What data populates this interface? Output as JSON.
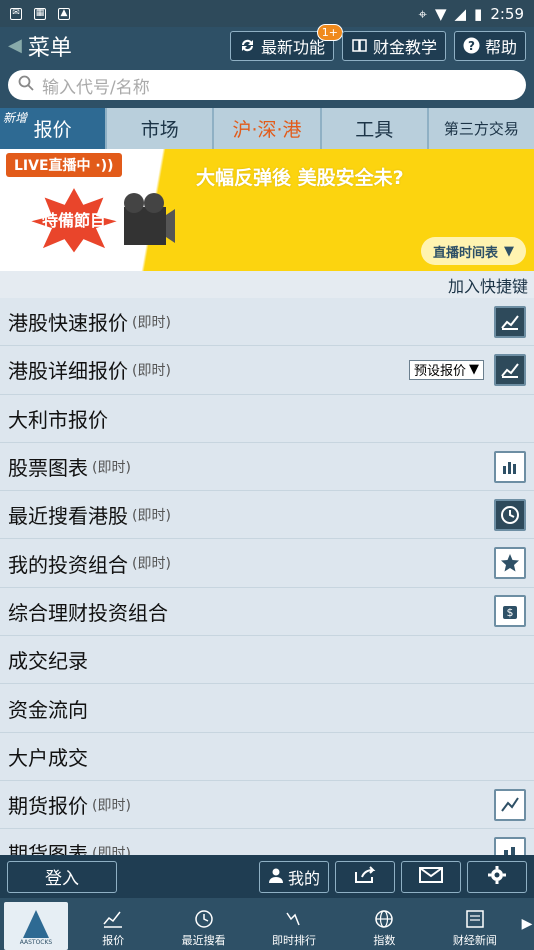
{
  "status_bar": {
    "time": "2:59"
  },
  "header": {
    "back_title": "菜单",
    "btn_new": "最新功能",
    "btn_new_badge": "1+",
    "btn_teach": "财金教学",
    "btn_help": "帮助"
  },
  "search": {
    "placeholder": "输入代号/名称"
  },
  "tabs": [
    {
      "label": "报价",
      "tag": "新增"
    },
    {
      "label": "市场"
    },
    {
      "label": "沪·深·港"
    },
    {
      "label": "工具"
    },
    {
      "label": "第三方交易"
    }
  ],
  "banner": {
    "live": "LIVE直播中",
    "special": "特備節目",
    "headline": "大幅反弹後 美股安全未?",
    "schedule": "直播时间表"
  },
  "shortcut": "加入快捷键",
  "rows": [
    {
      "label": "港股快速报价",
      "sub": "(即时)"
    },
    {
      "label": "港股详细报价",
      "sub": "(即时)",
      "select": "预设报价"
    },
    {
      "label": "大利市报价"
    },
    {
      "label": "股票图表",
      "sub": "(即时)"
    },
    {
      "label": "最近搜看港股",
      "sub": "(即时)"
    },
    {
      "label": "我的投资组合",
      "sub": "(即时)"
    },
    {
      "label": "综合理财投资组合"
    },
    {
      "label": "成交纪录"
    },
    {
      "label": "资金流向"
    },
    {
      "label": "大户成交"
    },
    {
      "label": "期货报价",
      "sub": "(即时)"
    },
    {
      "label": "期货图表",
      "sub": "(即时)"
    }
  ],
  "bottom": {
    "login": "登入",
    "mine": "我的"
  },
  "nav": {
    "logo": "AASTOCKS",
    "items": [
      "报价",
      "最近搜看",
      "即时排行",
      "指数",
      "财经新闻"
    ]
  }
}
